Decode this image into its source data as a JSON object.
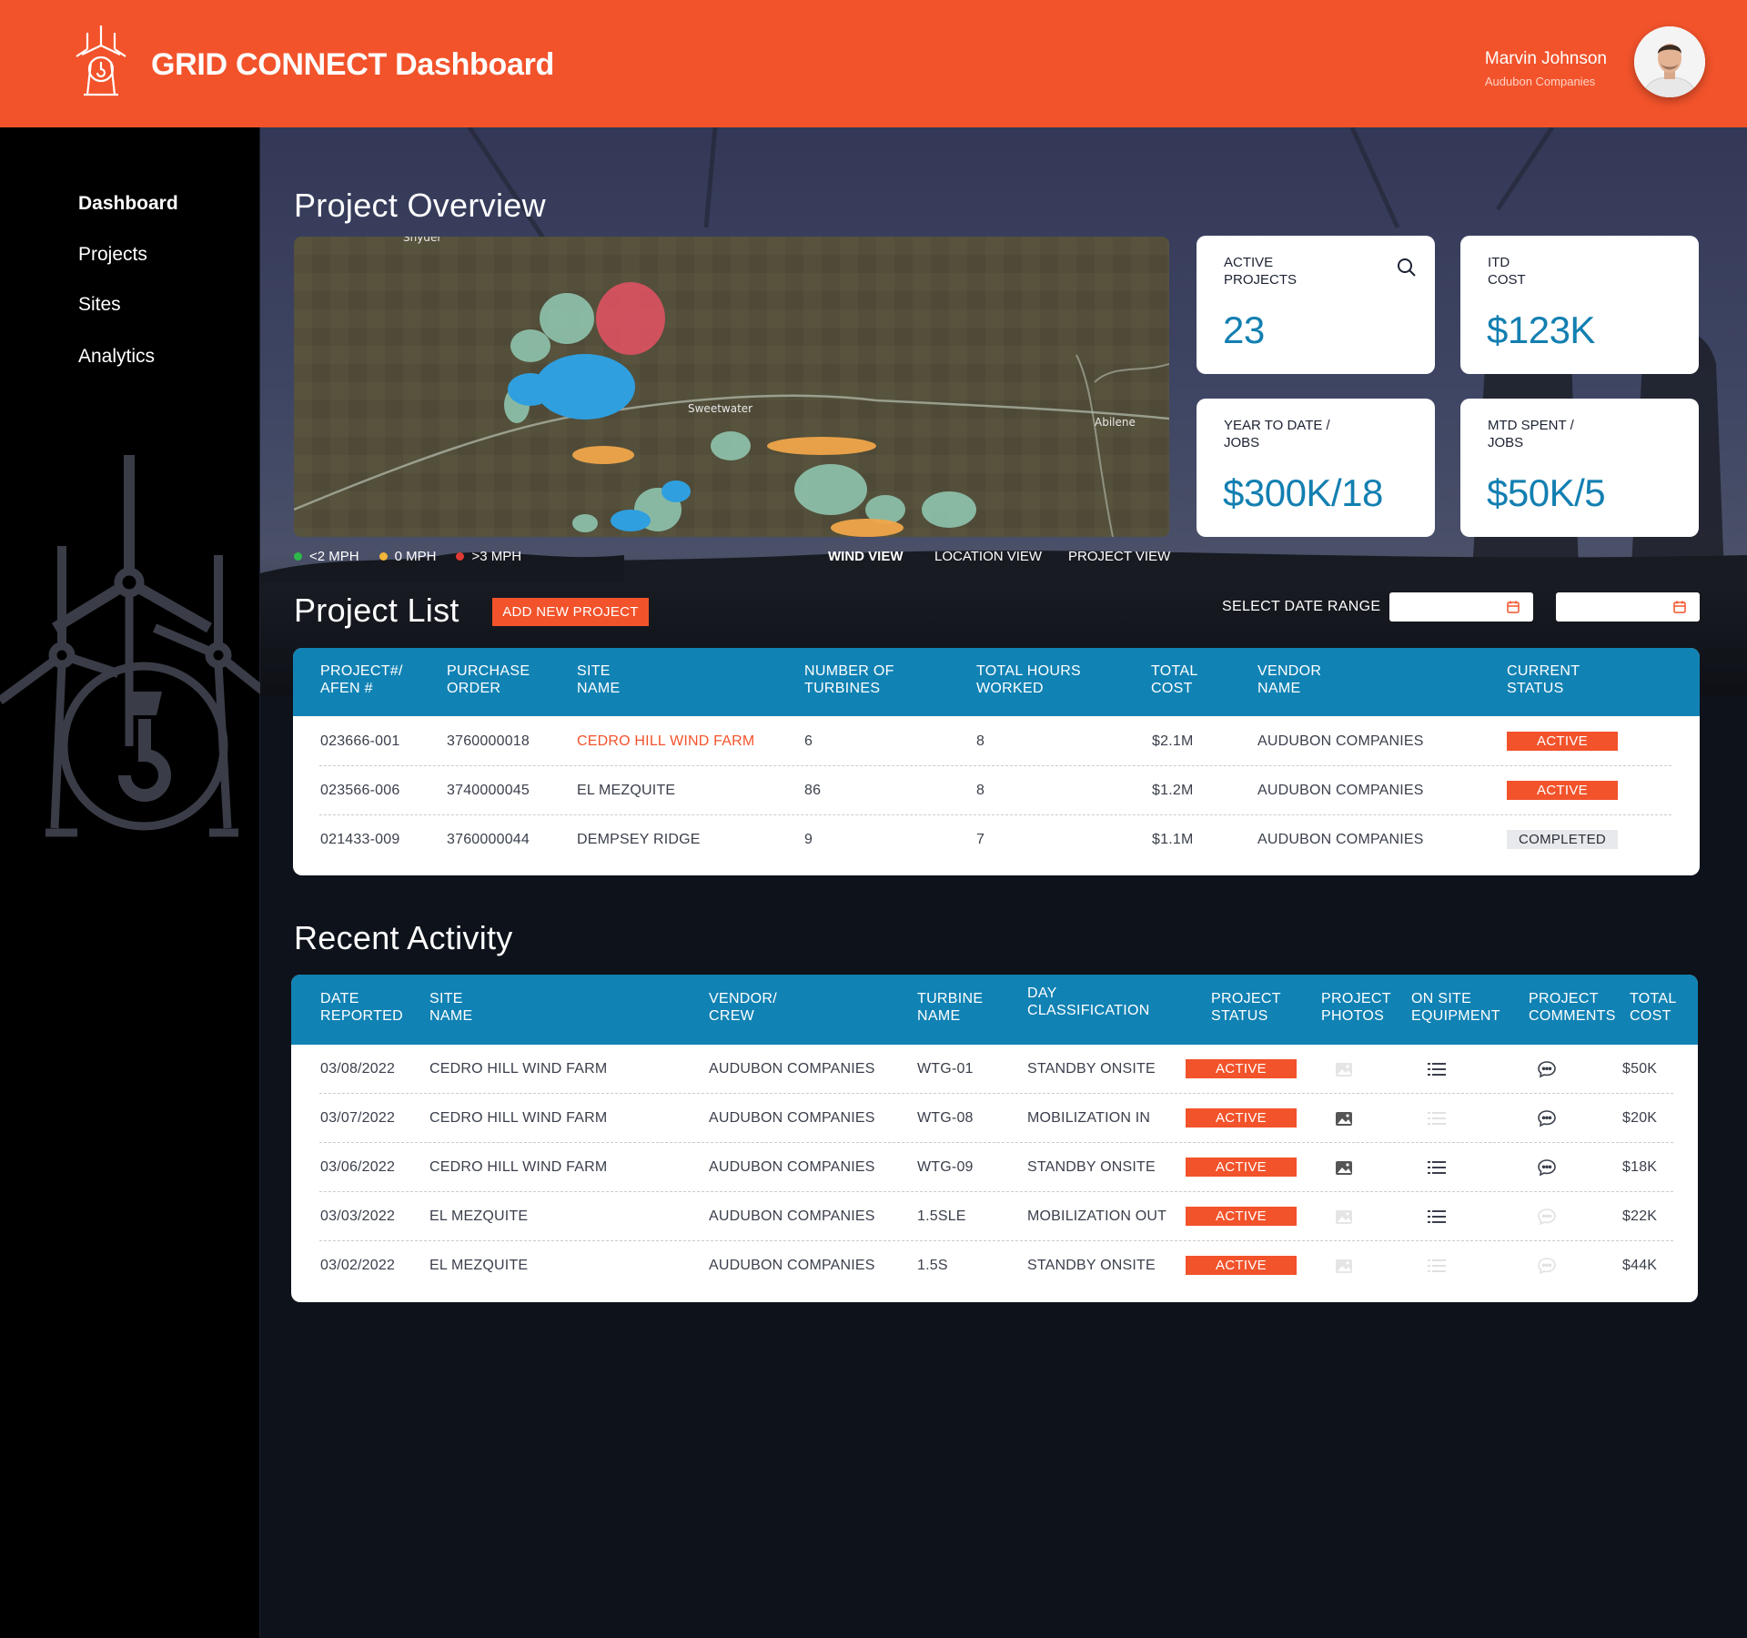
{
  "header": {
    "app_title": "GRID CONNECT Dashboard",
    "user_name": "Marvin Johnson",
    "user_company": "Audubon Companies"
  },
  "sidebar": {
    "items": [
      {
        "label": "Dashboard",
        "active": true
      },
      {
        "label": "Projects",
        "active": false
      },
      {
        "label": "Sites",
        "active": false
      },
      {
        "label": "Analytics",
        "active": false
      }
    ]
  },
  "overview": {
    "title": "Project Overview",
    "map_labels": {
      "town1": "Snyder",
      "town2": "Sweetwater",
      "town3": "Abilene"
    },
    "legend": [
      {
        "label": "<2 MPH",
        "color": "#2eb84b"
      },
      {
        "label": "0 MPH",
        "color": "#f4b63a"
      },
      {
        "label": ">3 MPH",
        "color": "#e13a35"
      }
    ],
    "views": [
      {
        "label": "WIND VIEW",
        "active": true
      },
      {
        "label": "LOCATION VIEW",
        "active": false
      },
      {
        "label": "PROJECT VIEW",
        "active": false
      }
    ]
  },
  "kpis": {
    "active_projects": {
      "label": "ACTIVE\nPROJECTS",
      "label1": "ACTIVE",
      "label2": "PROJECTS",
      "value": "23"
    },
    "itd_cost": {
      "label1": "ITD",
      "label2": "COST",
      "value": "$123K"
    },
    "ytd_jobs": {
      "label1": "YEAR TO DATE /",
      "label2": "JOBS",
      "value": "$300K/18"
    },
    "mtd_jobs": {
      "label1": "MTD SPENT /",
      "label2": "JOBS",
      "value": "$50K/5"
    }
  },
  "project_list": {
    "title": "Project List",
    "add_button": "ADD NEW PROJECT",
    "date_range_label": "SELECT DATE RANGE",
    "headers": [
      [
        "PROJECT#/",
        "AFEN #"
      ],
      [
        "PURCHASE",
        "ORDER"
      ],
      [
        "SITE",
        "NAME"
      ],
      [
        "NUMBER OF",
        "TURBINES"
      ],
      [
        "TOTAL HOURS",
        "WORKED"
      ],
      [
        "TOTAL",
        "COST"
      ],
      [
        "VENDOR",
        "NAME"
      ],
      [
        "CURRENT",
        "STATUS"
      ]
    ],
    "rows": [
      {
        "afen": "023666-001",
        "po": "3760000018",
        "site": "CEDRO HILL WIND FARM",
        "turbines": "6",
        "hours": "8",
        "cost": "$2.1M",
        "vendor": "AUDUBON COMPANIES",
        "status": "ACTIVE"
      },
      {
        "afen": "023566-006",
        "po": "3740000045",
        "site": "EL MEZQUITE",
        "turbines": "86",
        "hours": "8",
        "cost": "$1.2M",
        "vendor": "AUDUBON COMPANIES",
        "status": "ACTIVE"
      },
      {
        "afen": "021433-009",
        "po": "3760000044",
        "site": "DEMPSEY RIDGE",
        "turbines": "9",
        "hours": "7",
        "cost": "$1.1M",
        "vendor": "AUDUBON COMPANIES",
        "status": "COMPLETED"
      }
    ]
  },
  "recent_activity": {
    "title": "Recent Activity",
    "headers": [
      [
        "DATE",
        "REPORTED"
      ],
      [
        "SITE",
        "NAME"
      ],
      [
        "VENDOR/",
        "CREW"
      ],
      [
        "TURBINE",
        "NAME"
      ],
      [
        "DAY",
        "CLASSIFICATION"
      ],
      [
        "PROJECT",
        "STATUS"
      ],
      [
        "PROJECT",
        "PHOTOS"
      ],
      [
        "ON SITE",
        "EQUIPMENT"
      ],
      [
        "PROJECT",
        "COMMENTS"
      ],
      [
        "TOTAL",
        "COST"
      ]
    ],
    "rows": [
      {
        "date": "03/08/2022",
        "site": "CEDRO HILL WIND FARM",
        "vendor": "AUDUBON COMPANIES",
        "turbine": "WTG-01",
        "classification": "STANDBY ONSITE",
        "status": "ACTIVE",
        "photos": false,
        "equipment": true,
        "comments": true,
        "cost": "$50K"
      },
      {
        "date": "03/07/2022",
        "site": "CEDRO HILL WIND FARM",
        "vendor": "AUDUBON COMPANIES",
        "turbine": "WTG-08",
        "classification": "MOBILIZATION IN",
        "status": "ACTIVE",
        "photos": true,
        "equipment": false,
        "comments": true,
        "cost": "$20K"
      },
      {
        "date": "03/06/2022",
        "site": "CEDRO HILL WIND FARM",
        "vendor": "AUDUBON COMPANIES",
        "turbine": "WTG-09",
        "classification": "STANDBY ONSITE",
        "status": "ACTIVE",
        "photos": true,
        "equipment": true,
        "comments": true,
        "cost": "$18K"
      },
      {
        "date": "03/03/2022",
        "site": "EL MEZQUITE",
        "vendor": "AUDUBON COMPANIES",
        "turbine": "1.5SLE",
        "classification": "MOBILIZATION OUT",
        "status": "ACTIVE",
        "photos": false,
        "equipment": true,
        "comments": false,
        "cost": "$22K"
      },
      {
        "date": "03/02/2022",
        "site": "EL MEZQUITE",
        "vendor": "AUDUBON COMPANIES",
        "turbine": "1.5S",
        "classification": "STANDBY ONSITE",
        "status": "ACTIVE",
        "photos": false,
        "equipment": false,
        "comments": false,
        "cost": "$44K"
      }
    ]
  },
  "colors": {
    "brand": "#f2532b",
    "table_header": "#1182b4",
    "kpi_value": "#137fb1"
  },
  "icons": [
    "wind-turbine-logo-icon",
    "search-icon",
    "calendar-icon",
    "photo-icon",
    "list-icon",
    "comment-icon"
  ]
}
